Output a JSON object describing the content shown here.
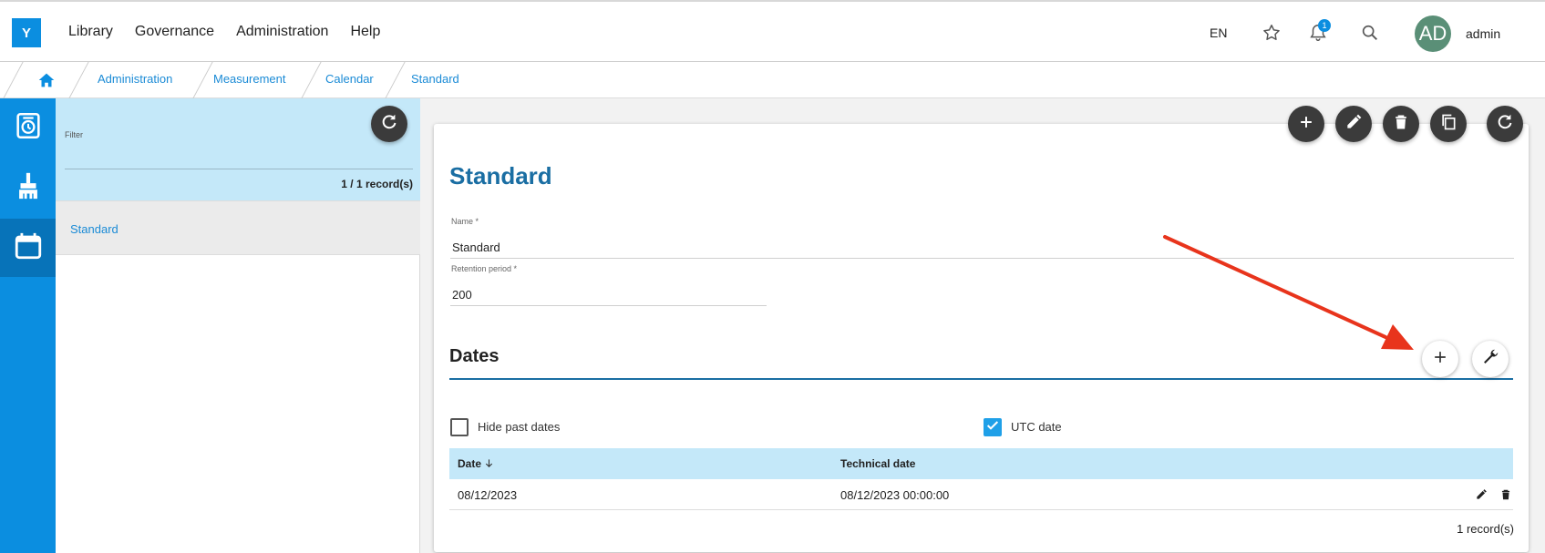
{
  "app": {
    "logo_letter": "Y"
  },
  "nav": {
    "items": [
      {
        "label": "Library"
      },
      {
        "label": "Governance"
      },
      {
        "label": "Administration"
      },
      {
        "label": "Help"
      }
    ]
  },
  "header": {
    "language": "EN",
    "notification_count": "1",
    "avatar_initials": "AD",
    "username": "admin"
  },
  "breadcrumb": {
    "items": [
      {
        "label": "Administration"
      },
      {
        "label": "Measurement"
      },
      {
        "label": "Calendar"
      },
      {
        "label": "Standard"
      }
    ]
  },
  "list": {
    "filter_label": "Filter",
    "records": "1 / 1 record(s)",
    "items": [
      {
        "label": "Standard"
      }
    ]
  },
  "detail": {
    "title": "Standard",
    "name_label": "Name *",
    "name_value": "Standard",
    "retention_label": "Retention period *",
    "retention_value": "200",
    "dates_title": "Dates",
    "hide_past_label": "Hide past dates",
    "hide_past_checked": false,
    "utc_label": "UTC date",
    "utc_checked": true,
    "table": {
      "headers": [
        "Date",
        "Technical date"
      ],
      "rows": [
        {
          "date": "08/12/2023",
          "technical": "08/12/2023 00:00:00"
        }
      ]
    },
    "records": "1 record(s)"
  },
  "colors": {
    "brand": "#0b8ee0",
    "title": "#1a6ea3",
    "filter_bg": "#c4e8f9",
    "arrow": "#e8341c"
  },
  "icons": {
    "header": [
      "star-icon",
      "bell-icon",
      "search-icon"
    ],
    "rail": [
      "timer-icon",
      "broom-icon",
      "calendar-icon"
    ],
    "card_toolbar": [
      "add-icon",
      "edit-icon",
      "delete-icon",
      "copy-icon",
      "refresh-icon"
    ],
    "dates_toolbar": [
      "add-icon",
      "wrench-icon"
    ]
  }
}
